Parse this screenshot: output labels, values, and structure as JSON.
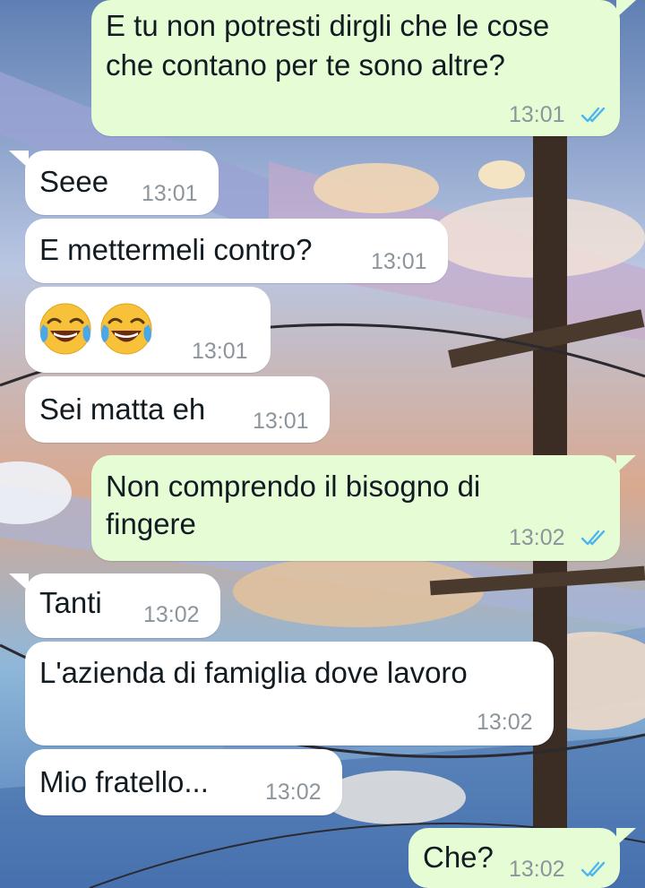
{
  "chat": {
    "messages": [
      {
        "direction": "outgoing",
        "lines": [
          "E tu non potresti dirgli che le cose",
          "che contano per te sono altre?"
        ],
        "time": "13:01",
        "status": "read"
      },
      {
        "direction": "incoming",
        "text": "Seee",
        "time": "13:01"
      },
      {
        "direction": "incoming",
        "text": "E mettermeli contro?",
        "time": "13:01"
      },
      {
        "direction": "incoming",
        "emoji": [
          "face-with-tears-of-joy",
          "face-with-tears-of-joy"
        ],
        "time": "13:01"
      },
      {
        "direction": "incoming",
        "text": "Sei matta eh",
        "time": "13:01"
      },
      {
        "direction": "outgoing",
        "lines": [
          "Non comprendo il bisogno di",
          "fingere"
        ],
        "time": "13:02",
        "status": "read"
      },
      {
        "direction": "incoming",
        "text": "Tanti",
        "time": "13:02"
      },
      {
        "direction": "incoming",
        "text": "L'azienda di famiglia dove lavoro",
        "time": "13:02"
      },
      {
        "direction": "incoming",
        "text": "Mio fratello...",
        "time": "13:02"
      },
      {
        "direction": "outgoing",
        "text": "Che?",
        "time": "13:02",
        "status": "read"
      }
    ]
  },
  "colors": {
    "outgoing_bubble": "#e6fcd5",
    "incoming_bubble": "#ffffff",
    "read_ticks": "#4fb6ec",
    "timestamp": "#8c959b"
  }
}
